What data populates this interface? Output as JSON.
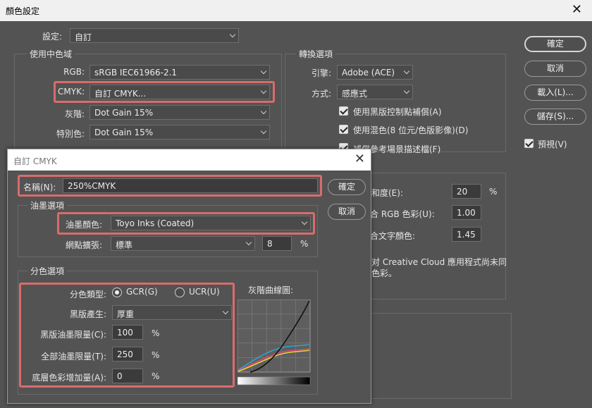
{
  "window": {
    "title": "顏色設定",
    "close": "✕"
  },
  "settings": {
    "label": "設定:",
    "value": "自訂"
  },
  "working_spaces": {
    "legend": "使用中色域",
    "rgb_label": "RGB:",
    "rgb_value": "sRGB IEC61966-2.1",
    "cmyk_label": "CMYK:",
    "cmyk_value": "自訂 CMYK...",
    "gray_label": "灰階:",
    "gray_value": "Dot Gain 15%",
    "spot_label": "特別色:",
    "spot_value": "Dot Gain 15%"
  },
  "conversion": {
    "legend": "轉換選項",
    "engine_label": "引擎:",
    "engine_value": "Adobe (ACE)",
    "intent_label": "方式:",
    "intent_value": "感應式",
    "opt1": "使用黑版控制點補償(A)",
    "opt2": "使用混色(8 位元/色版影像)(D)",
    "opt3": "補償參考場景描述檔(F)"
  },
  "advanced": {
    "desat_label": "和度(E):",
    "desat_value": "20",
    "desat_unit": "%",
    "blend_label": "合 RGB 色彩(U):",
    "blend_value": "1.00",
    "text_label": "合文字顏色:",
    "text_value": "1.45",
    "desc_line1": "对 Creative Cloud 應用程式尚未同",
    "desc_line2": "色彩。"
  },
  "buttons": {
    "ok": "確定",
    "cancel": "取消",
    "load": "載入(L)...",
    "save": "儲存(S)...",
    "preview": "預視(V)"
  },
  "cmyk_dialog": {
    "title": "自訂 CMYK",
    "close": "✕",
    "name_label": "名稱(N):",
    "name_value": "250%CMYK",
    "ok": "確定",
    "cancel": "取消",
    "ink": {
      "legend": "油墨選項",
      "colors_label": "油墨顏色:",
      "colors_value": "Toyo Inks (Coated)",
      "dot_gain_label": "網點擴張:",
      "dot_gain_value": "標準",
      "dot_gain_num": "8",
      "dot_gain_unit": "%"
    },
    "separation": {
      "legend": "分色選項",
      "type_label": "分色類型:",
      "gcr": "GCR(G)",
      "ucr": "UCR(U)",
      "black_gen_label": "黑版產生:",
      "black_gen_value": "厚重",
      "black_limit_label": "黑版油墨限量(C):",
      "black_limit_value": "100",
      "black_limit_unit": "%",
      "total_limit_label": "全部油墨限量(T):",
      "total_limit_value": "250",
      "total_limit_unit": "%",
      "ucr_amount_label": "底層色彩增加量(A):",
      "ucr_amount_value": "0",
      "ucr_amount_unit": "%",
      "curve_label": "灰階曲線圖:"
    }
  },
  "colors": {
    "highlight": "#d96c6c",
    "cyan": "#2aa6c9",
    "magenta": "#d9487a",
    "yellow": "#e8d33a",
    "black": "#111111"
  }
}
